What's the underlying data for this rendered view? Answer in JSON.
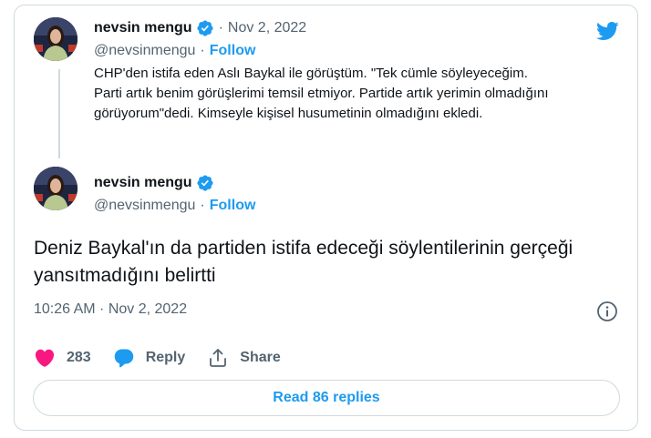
{
  "quoted_tweet": {
    "author_name": "nevsin mengu",
    "author_handle": "@nevsinmengu",
    "date": "Nov 2, 2022",
    "separator": "·",
    "follow_label": "Follow",
    "text": "CHP'den istifa eden Aslı Baykal ile görüştüm. \"Tek cümle söyleyeceğim. Parti artık benim görüşlerimi temsil etmiyor. Partide artık yerimin olmadığını görüyorum\"dedi. Kimseyle kişisel husumetinin olmadığını ekledi."
  },
  "main_tweet": {
    "author_name": "nevsin mengu",
    "author_handle": "@nevsinmengu",
    "separator": "·",
    "follow_label": "Follow",
    "text": "Deniz Baykal'ın da partiden istifa edeceği söylentilerinin gerçeği yansıtmadığını belirtti",
    "timestamp": "10:26 AM · Nov 2, 2022"
  },
  "actions": {
    "like_count": "283",
    "reply_label": "Reply",
    "share_label": "Share"
  },
  "read_replies_label": "Read 86 replies",
  "icons": {
    "brand": "twitter-bird-icon",
    "verified": "verified-badge-icon",
    "like": "heart-icon",
    "reply": "speech-bubble-icon",
    "share": "share-icon",
    "info": "info-icon"
  },
  "colors": {
    "accent": "#1d9bf0",
    "like": "#f91880",
    "secondary_text": "#536471",
    "border": "#cfd9de"
  }
}
